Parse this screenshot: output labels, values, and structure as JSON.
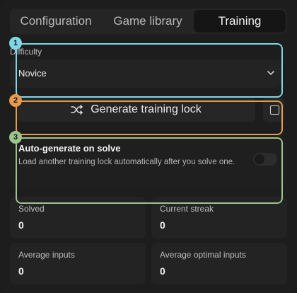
{
  "tabs": [
    "Configuration",
    "Game library",
    "Training"
  ],
  "difficulty": {
    "label": "Difficulty",
    "value": "Novice"
  },
  "generate_button": {
    "label": "Generate training lock"
  },
  "auto_generate": {
    "title": "Auto-generate on solve",
    "description": "Load another training lock automatically after you solve one.",
    "enabled": false
  },
  "stats": [
    {
      "label": "Solved",
      "value": "0"
    },
    {
      "label": "Current streak",
      "value": "0"
    },
    {
      "label": "Average inputs",
      "value": "0"
    },
    {
      "label": "Average optimal inputs",
      "value": "0"
    }
  ],
  "callouts": [
    {
      "number": "1",
      "color": "#7fd7e6"
    },
    {
      "number": "2",
      "color": "#e89a4c"
    },
    {
      "number": "3",
      "color": "#9cc58d"
    }
  ]
}
